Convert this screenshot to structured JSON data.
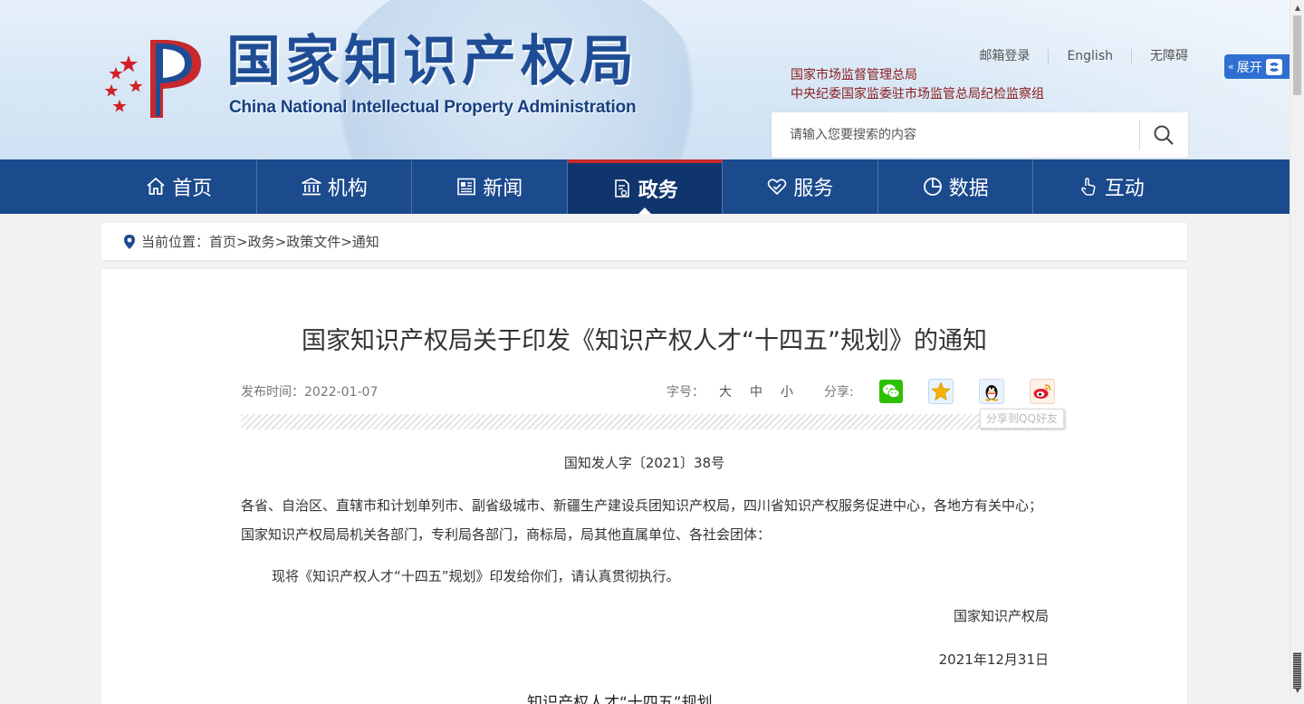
{
  "site": {
    "cn_name": "国家知识产权局",
    "en_name": "China National Intellectual Property Administration"
  },
  "toplinks": [
    "邮箱登录",
    "English",
    "无障碍"
  ],
  "orgs": [
    "国家市场监督管理总局",
    "中央纪委国家监委驻市场监管总局纪检监察组"
  ],
  "search": {
    "placeholder": "请输入您要搜索的内容"
  },
  "expand_label": "展开",
  "nav": [
    {
      "label": "首页",
      "icon": "home-icon"
    },
    {
      "label": "机构",
      "icon": "institution-icon"
    },
    {
      "label": "新闻",
      "icon": "newspaper-icon"
    },
    {
      "label": "政务",
      "icon": "document-icon",
      "active": true
    },
    {
      "label": "服务",
      "icon": "service-heart-icon"
    },
    {
      "label": "数据",
      "icon": "pie-chart-icon"
    },
    {
      "label": "互动",
      "icon": "hand-pointer-icon"
    }
  ],
  "breadcrumb": {
    "prefix": "当前位置：",
    "items": [
      "首页",
      "政务",
      "政策文件",
      "通知"
    ]
  },
  "article": {
    "title": "国家知识产权局关于印发《知识产权人才“十四五”规划》的通知",
    "publish_label": "发布时间：",
    "publish_date": "2022-01-07",
    "fontsize_label": "字号：",
    "fontsizes": [
      "大",
      "中",
      "小"
    ],
    "share_label": "分享:",
    "share_tooltip": "分享到QQ好友",
    "doc_number": "国知发人字〔2021〕38号",
    "addressee": "各省、自治区、直辖市和计划单列市、副省级城市、新疆生产建设兵团知识产权局，四川省知识产权服务促进中心，各地方有关中心；国家知识产权局局机关各部门，专利局各部门，商标局，局其他直属单位、各社会团体：",
    "paragraph": "现将《知识产权人才“十四五”规划》印发给你们，请认真贯彻执行。",
    "signer": "国家知识产权局",
    "sign_date": "2021年12月31日",
    "next_heading_partial": "知识产权人才“十四五”规划"
  },
  "colors": {
    "nav_bg": "#1b4a8d",
    "nav_active": "#10356d",
    "accent_red": "#c8292d",
    "org_text": "#8b1b1b",
    "brand_blue": "#1f4d95",
    "expand_btn": "#2e6fd1"
  }
}
